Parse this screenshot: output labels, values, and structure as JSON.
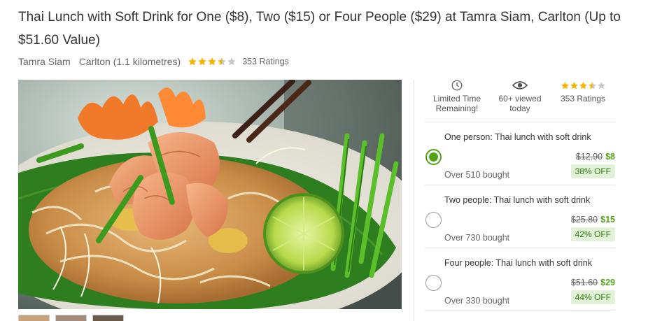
{
  "deal": {
    "title": "Thai Lunch with Soft Drink for One ($8), Two ($15) or Four People ($29) at Tamra Siam, Carlton (Up to $51.60 Value)",
    "merchant": "Tamra Siam",
    "location": "Carlton (1.1 kilometres)",
    "rating": 3.5,
    "ratings_count": "353 Ratings"
  },
  "stats": {
    "time": {
      "line1": "Limited Time",
      "line2": "Remaining!",
      "icon": "clock-icon"
    },
    "viewed": {
      "line1": "60+ viewed",
      "line2": "today",
      "icon": "eye-icon"
    },
    "ratings": {
      "line1": "353 Ratings",
      "icon": "star-rating-icon"
    }
  },
  "options": [
    {
      "name": "One person: Thai lunch with soft drink",
      "was": "$12.90",
      "now": "$8",
      "off": "38% OFF",
      "bought": "Over 510 bought",
      "selected": true
    },
    {
      "name": "Two people: Thai lunch with soft drink",
      "was": "$25.80",
      "now": "$15",
      "off": "42% OFF",
      "bought": "Over 730 bought",
      "selected": false
    },
    {
      "name": "Four people: Thai lunch with soft drink",
      "was": "$51.60",
      "now": "$29",
      "off": "44% OFF",
      "bought": "Over 330 bought",
      "selected": false
    }
  ],
  "colors": {
    "accent": "#53a318",
    "star": "#f5b400",
    "star_empty": "#c8c8c8"
  },
  "hero_image": {
    "icon": "pad-thai-photo"
  }
}
